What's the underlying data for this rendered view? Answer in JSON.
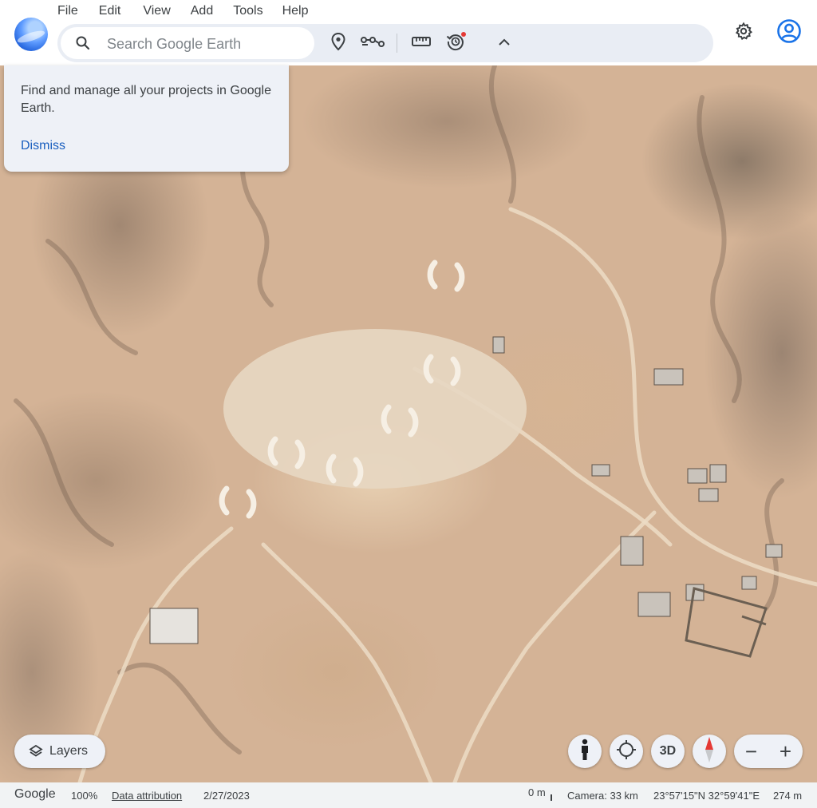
{
  "menu": [
    "File",
    "Edit",
    "View",
    "Add",
    "Tools",
    "Help"
  ],
  "search": {
    "placeholder": "Search Google Earth",
    "value": ""
  },
  "toolbar_icons": [
    "placemark-icon",
    "path-icon",
    "ruler-icon",
    "history-icon",
    "collapse-icon"
  ],
  "popup": {
    "text": "Find and manage all your projects in Google Earth.",
    "dismiss_label": "Dismiss"
  },
  "controls": {
    "layers_label": "Layers",
    "three_d_label": "3D",
    "zoom_out_label": "−",
    "zoom_in_label": "+"
  },
  "status": {
    "brand": "Google",
    "zoom": "100%",
    "attribution": "Data attribution",
    "date": "2/27/2023",
    "scale": "0 m",
    "camera": "Camera: 33 km",
    "coordinates": "23°57'15\"N 32°59'41\"E",
    "elevation": "274 m"
  },
  "colors": {
    "accent": "#1a73e8",
    "link": "#1a5fbf",
    "notification": "#e53935",
    "compass_north": "#e53935"
  }
}
